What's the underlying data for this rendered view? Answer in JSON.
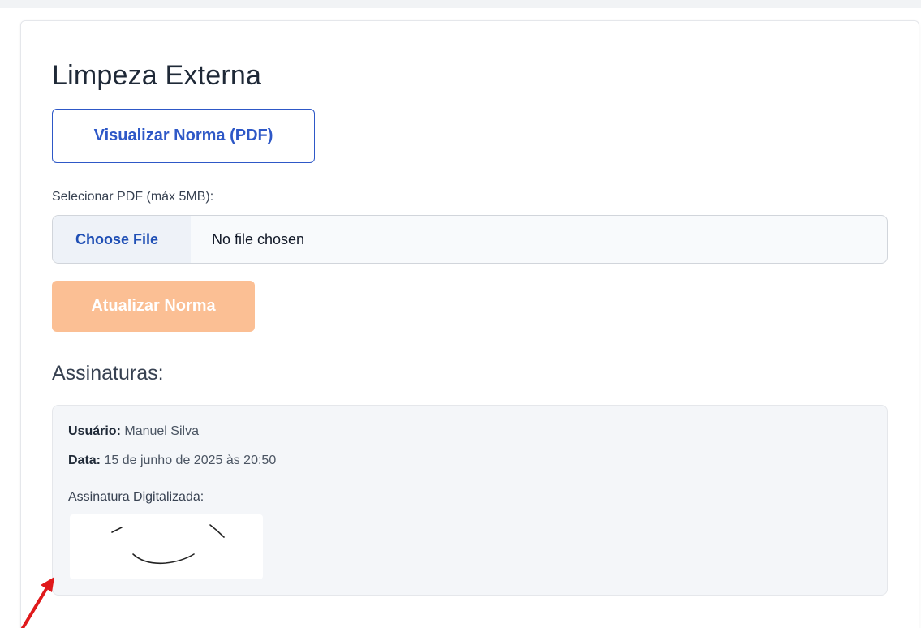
{
  "page": {
    "title": "Limpeza Externa"
  },
  "actions": {
    "view_norm_label": "Visualizar Norma (PDF)",
    "update_norm_label": "Atualizar Norma"
  },
  "upload": {
    "label": "Selecionar PDF (máx 5MB):",
    "choose_label": "Choose File",
    "status": "No file chosen"
  },
  "signatures": {
    "heading": "Assinaturas:",
    "items": [
      {
        "user_label": "Usuário:",
        "user_value": "Manuel Silva",
        "date_label": "Data:",
        "date_value": "15 de junho de 2025 às 20:50",
        "image_label": "Assinatura Digitalizada:"
      }
    ]
  },
  "colors": {
    "primary": "#2e58c7",
    "accent_disabled": "#fbbf94",
    "annotation_arrow": "#e0191b"
  }
}
